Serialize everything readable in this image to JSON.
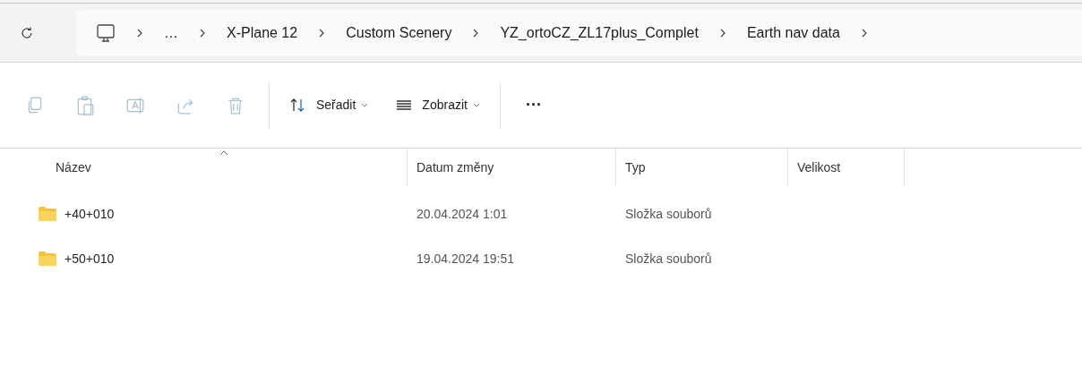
{
  "address_bar": {
    "crumbs": [
      "…",
      "X-Plane 12",
      "Custom Scenery",
      "YZ_ortoCZ_ZL17plus_Complet",
      "Earth nav data"
    ]
  },
  "toolbar": {
    "actions": [
      {
        "disabled": true
      },
      {
        "disabled": true
      },
      {
        "disabled": true
      },
      {
        "disabled": true
      },
      {
        "disabled": true
      }
    ],
    "menus": [
      {
        "label": "Seřadit"
      },
      {
        "label": "Zobrazit"
      }
    ],
    "more": "···"
  },
  "table": {
    "columns": [
      {
        "label": "Název",
        "sorted": true
      },
      {
        "label": "Datum změny",
        "sorted": false
      },
      {
        "label": "Typ",
        "sorted": false
      },
      {
        "label": "Velikost",
        "sorted": false
      }
    ],
    "rows": [
      {
        "name": "+40+010",
        "date": "20.04.2024 1:01",
        "type": "Složka souborů"
      },
      {
        "name": "+50+010",
        "date": "19.04.2024 19:51",
        "type": "Složka souborů"
      }
    ]
  }
}
